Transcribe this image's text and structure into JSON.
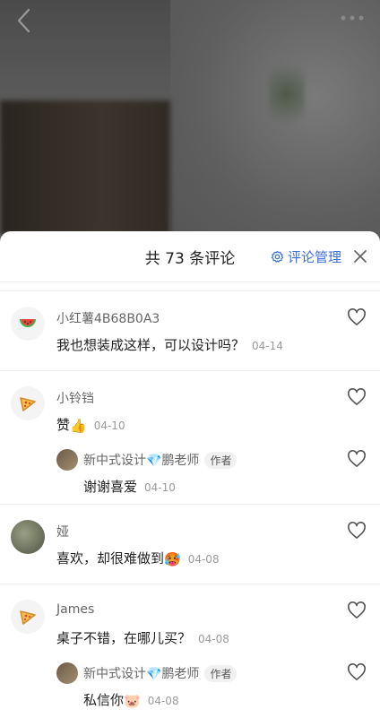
{
  "sheet": {
    "title": "共 73 条评论",
    "manage_label": "评论管理"
  },
  "comments": [
    {
      "user": "小红薯4B68B0A3",
      "avatar": "watermelon-icon",
      "text": "我也想装成这样，可以设计吗？",
      "date": "04-14"
    },
    {
      "user": "小铃铛",
      "avatar": "pizza-icon",
      "text": "赞",
      "text_emoji": "👍",
      "date": "04-10",
      "reply": {
        "user": "新中式设计",
        "user_emoji": "💎",
        "user_suffix": "鹏老师",
        "tag": "作者",
        "text": "谢谢喜爱",
        "date": "04-10"
      }
    },
    {
      "user": "娅",
      "avatar": "photo-avatar",
      "text": "喜欢，却很难做到",
      "text_emoji": "🥵",
      "date": "04-08"
    },
    {
      "user": "James",
      "avatar": "pizza-icon",
      "text": "桌子不错，在哪儿买？",
      "date": "04-08",
      "reply": {
        "user": "新中式设计",
        "user_emoji": "💎",
        "user_suffix": "鹏老师",
        "tag": "作者",
        "text": "私信你",
        "text_emoji": "🐷",
        "date": "04-08"
      }
    }
  ]
}
